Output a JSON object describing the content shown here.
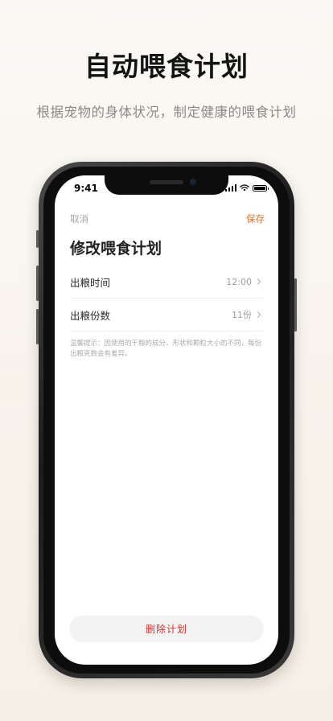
{
  "hero": {
    "title": "自动喂食计划",
    "subtitle": "根据宠物的身体状况，制定健康的喂食计划"
  },
  "status_bar": {
    "time": "9:41"
  },
  "nav": {
    "cancel_label": "取消",
    "save_label": "保存"
  },
  "page": {
    "title": "修改喂食计划"
  },
  "settings": [
    {
      "label": "出粮时间",
      "value": "12:00"
    },
    {
      "label": "出粮份数",
      "value": "11份"
    }
  ],
  "tip": "温馨提示：因使用的干粮的成分、形状和颗粒大小的不同，每份出粮克数会有差异。",
  "actions": {
    "delete_label": "删除计划"
  },
  "colors": {
    "accent": "#e0702f",
    "danger": "#d0302e",
    "muted": "#a5a5a5"
  },
  "icons": {
    "row_chevron": "chevron-right-icon",
    "wifi": "wifi-icon",
    "signal": "signal-icon",
    "battery": "battery-icon"
  }
}
